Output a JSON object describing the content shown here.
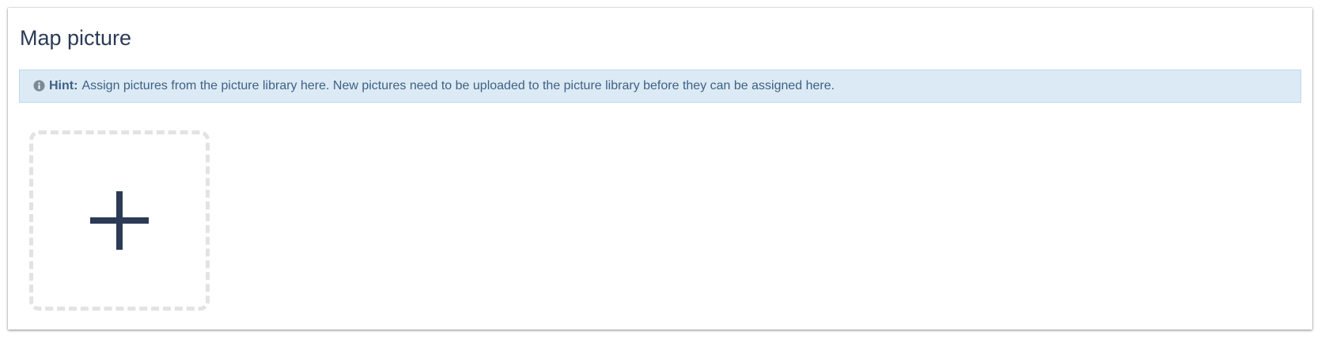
{
  "section": {
    "title": "Map picture"
  },
  "hint": {
    "label": "Hint:",
    "text": "Assign pictures from the picture library here. New pictures need to be uploaded to the picture library before they can be assigned here.",
    "icon": "info-circle-icon"
  },
  "add_tile": {
    "icon": "plus-icon"
  },
  "colors": {
    "title_text": "#2b3a55",
    "hint_background": "#dceaf5",
    "hint_border": "#bcd8ea",
    "hint_text": "#3e6184",
    "dashed_border": "#e3e3e3",
    "plus": "#2b3a55"
  }
}
